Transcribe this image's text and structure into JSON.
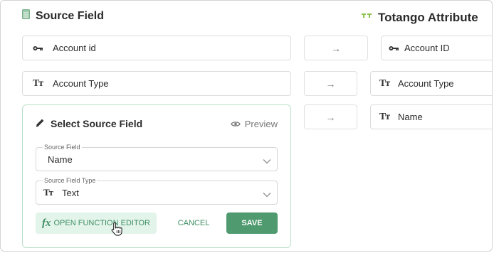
{
  "source_header": {
    "title": "Source Field",
    "icon": "spreadsheet-icon"
  },
  "target_header": {
    "title": "Totango Attribute",
    "icon": "totango-logo-icon",
    "accent": "#8bc34a"
  },
  "rows": [
    {
      "source": "Account id",
      "source_icon": "key-icon",
      "arrow": "→",
      "target": "Account ID",
      "target_icon": "key-icon"
    },
    {
      "source": "Account Type",
      "source_icon": "text-type-icon",
      "arrow": "→",
      "target": "Account Type",
      "target_icon": "text-type-icon"
    },
    {
      "arrow": "→",
      "target": "Name",
      "target_icon": "text-type-icon"
    }
  ],
  "editor": {
    "title": "Select Source Field",
    "preview_label": "Preview",
    "source_field": {
      "label": "Source Field",
      "value": "Name"
    },
    "source_field_type": {
      "label": "Source Field Type",
      "value": "Text"
    },
    "fx_label": "fx",
    "open_function_editor": "OPEN FUNCTION EDITOR",
    "cancel": "CANCEL",
    "save": "SAVE"
  },
  "colors": {
    "accent_green": "#4f9a6f",
    "panel_border": "#b9e0c6",
    "fx_bg": "#e3f4ea"
  },
  "text_icon_glyph": "Tт"
}
